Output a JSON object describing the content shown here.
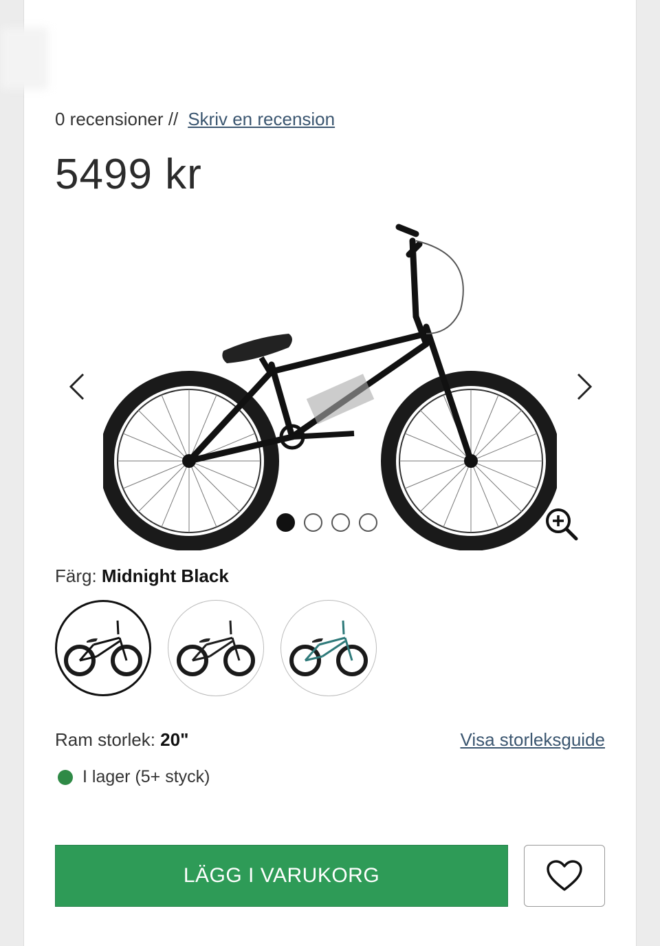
{
  "reviews": {
    "count_text": "0 recensioner //",
    "write_review_link": "Skriv en recension"
  },
  "price": "5499 kr",
  "gallery": {
    "prev_icon": "chevron-left-icon",
    "next_icon": "chevron-right-icon",
    "zoom_icon": "zoom-in-icon",
    "dot_count": 4,
    "active_dot": 0
  },
  "color": {
    "label": "Färg:",
    "selected": "Midnight Black",
    "swatch_frame_colors": [
      "#111111",
      "#1d1d1d",
      "#2f7a7a"
    ]
  },
  "size": {
    "label": "Ram storlek:",
    "value": "20\"",
    "guide_link": "Visa storleksguide"
  },
  "stock": {
    "text": "I lager (5+ styck)",
    "color": "#2f8a46"
  },
  "actions": {
    "add_to_cart": "LÄGG I VARUKORG",
    "wishlist_icon": "heart-icon",
    "accent": "#2e9b57"
  }
}
